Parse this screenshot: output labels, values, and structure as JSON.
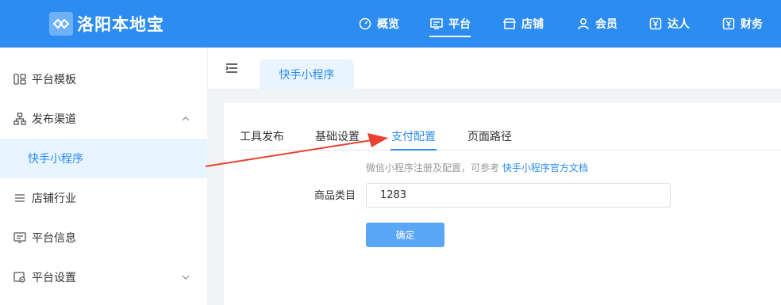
{
  "header": {
    "app_title": "洛阳本地宝",
    "nav": [
      {
        "label": "概览",
        "icon": "dashboard-icon"
      },
      {
        "label": "平台",
        "icon": "monitor-icon",
        "active": true
      },
      {
        "label": "店铺",
        "icon": "store-icon"
      },
      {
        "label": "会员",
        "icon": "user-icon"
      },
      {
        "label": "达人",
        "icon": "yen-card-icon"
      },
      {
        "label": "财务",
        "icon": "finance-icon"
      }
    ],
    "brand_color": "#2d8cf0"
  },
  "sidebar": {
    "items": [
      {
        "label": "平台模板",
        "icon": "template-icon"
      },
      {
        "label": "发布渠道",
        "icon": "sitemap-icon",
        "expanded": true
      },
      {
        "label": "快手小程序",
        "active": true
      },
      {
        "label": "店铺行业",
        "icon": "list-icon"
      },
      {
        "label": "平台信息",
        "icon": "message-icon"
      },
      {
        "label": "平台设置",
        "icon": "settings-icon"
      }
    ]
  },
  "page_tab": {
    "label": "快手小程序"
  },
  "subtabs": [
    {
      "label": "工具发布"
    },
    {
      "label": "基础设置"
    },
    {
      "label": "支付配置",
      "active": true
    },
    {
      "label": "页面路径"
    }
  ],
  "form": {
    "hint_text": "微信小程序注册及配置，可参考 ",
    "hint_link": "快手小程序官方文档",
    "category_label": "商品类目",
    "category_value": "1283",
    "submit_label": "确定"
  },
  "annotation_color": "#e8412f"
}
